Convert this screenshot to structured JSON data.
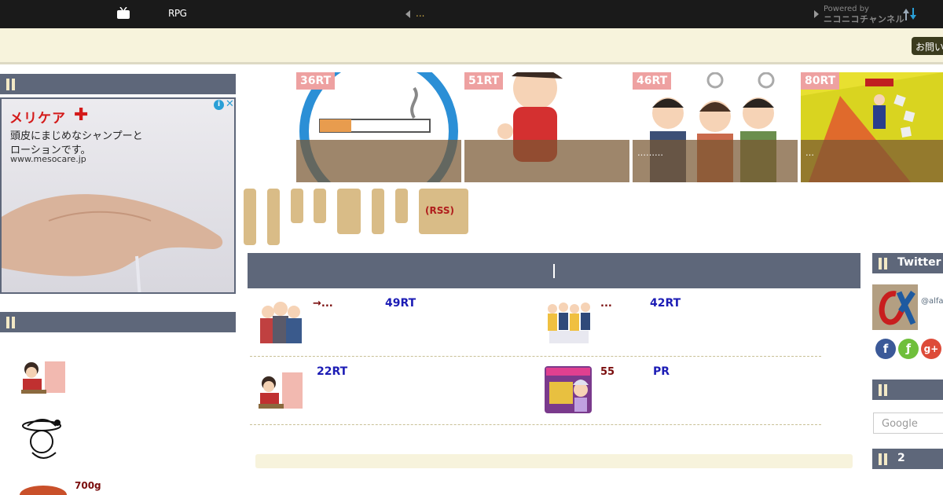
{
  "topbar": {
    "title": "RPG",
    "center_text": "...",
    "powered_by": "Powered by",
    "channel": "ニコニコチャンネル"
  },
  "header": {
    "contact_button": "お問い"
  },
  "ad": {
    "brand": "メリケア",
    "copy_line1": "頭皮にまじめなシャンプーと",
    "copy_line2": "ローションです。",
    "url": "www.mesocare.jp"
  },
  "featured": [
    {
      "rt": "36RT",
      "caption": ""
    },
    {
      "rt": "51RT",
      "caption": ""
    },
    {
      "rt": "46RT",
      "caption": "………"
    },
    {
      "rt": "80RT",
      "caption": "…"
    }
  ],
  "tags": {
    "rss_label": "(RSS)"
  },
  "articles": [
    {
      "title": "→...",
      "rt": "49RT"
    },
    {
      "title": "...",
      "rt": "42RT"
    },
    {
      "title": "",
      "rt": "22RT"
    },
    {
      "title": "55",
      "rt": "PR"
    }
  ],
  "left_sidebar": {
    "item3_text": "700g"
  },
  "right_sidebar": {
    "twitter_title": "Twitter",
    "handle": "@alfa",
    "search_placeholder": "Google",
    "ranking_title": "2"
  },
  "colors": {
    "topbar": "#1a1a1a",
    "cream": "#f7f3dc",
    "section_head": "#5e677a",
    "tag": "#d9bc87",
    "rt_badge": "#eea1a1",
    "rt_text": "#1c1cb5",
    "title_text": "#7a0d0d"
  }
}
